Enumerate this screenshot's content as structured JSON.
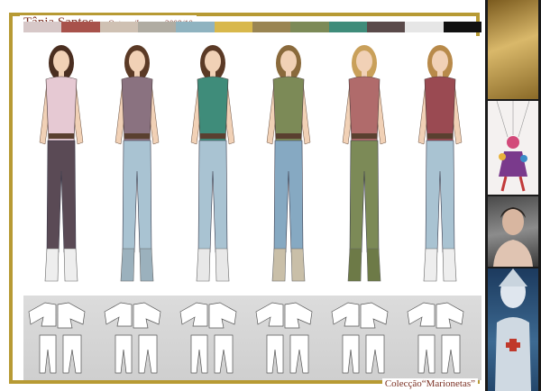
{
  "header": {
    "designer": "Tânia Santos",
    "separator": "-",
    "season": "Outono/Inverno 2009/10"
  },
  "palette": [
    "#d7c8c8",
    "#a8524b",
    "#cfc1b3",
    "#b0aca2",
    "#8fb3c0",
    "#d8b84c",
    "#9a8552",
    "#7c8a57",
    "#3f8c7a",
    "#5a4a4a",
    "#e6e6e6",
    "#111111"
  ],
  "colors": {
    "frame_border": "#b79a34",
    "title_text": "#7a2f22"
  },
  "figures": [
    {
      "top": "#e6c9d3",
      "bottom": "#5a4a55",
      "hair": "#4a2e20",
      "skin": "#f1d1b6",
      "boots": "#eeeeee"
    },
    {
      "top": "#8a7280",
      "bottom": "#a9c3d2",
      "hair": "#5b3a26",
      "skin": "#f1d1b6",
      "boots": "#9bb1bd"
    },
    {
      "top": "#3f8c7a",
      "bottom": "#a9c3d2",
      "hair": "#5b3a26",
      "skin": "#f1d1b6",
      "boots": "#e8e8e8"
    },
    {
      "top": "#7c8a57",
      "bottom": "#86a9c2",
      "hair": "#8a6a3c",
      "skin": "#f1d1b6",
      "boots": "#c9bfa8"
    },
    {
      "top": "#b06b6b",
      "bottom": "#7c8a57",
      "hair": "#c9a05a",
      "skin": "#f1d1b6",
      "boots": "#6d7a47"
    },
    {
      "top": "#9a4a52",
      "bottom": "#a9c3d2",
      "hair": "#b88a4a",
      "skin": "#f1d1b6",
      "boots": "#eeeeee"
    }
  ],
  "caption": {
    "text": "Colecção“Marionetas”"
  }
}
